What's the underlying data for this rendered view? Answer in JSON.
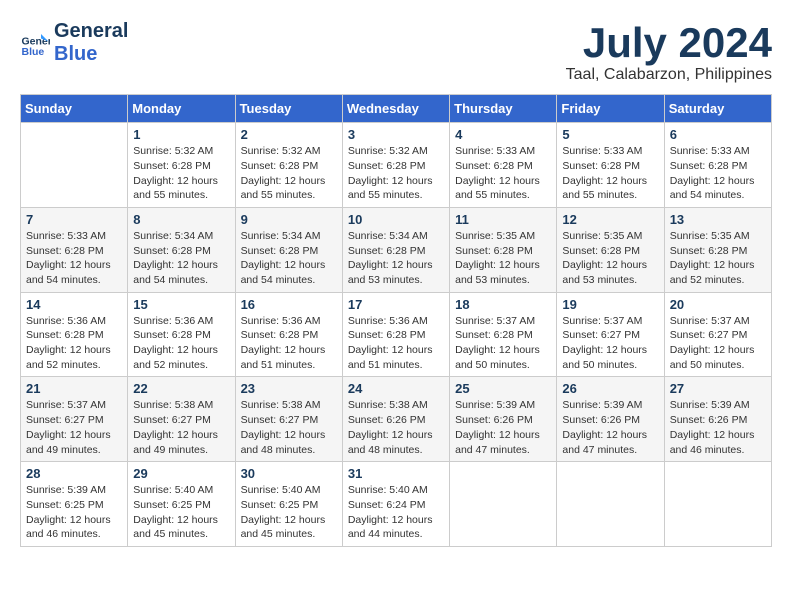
{
  "header": {
    "logo_line1": "General",
    "logo_line2": "Blue",
    "month": "July 2024",
    "location": "Taal, Calabarzon, Philippines"
  },
  "days_of_week": [
    "Sunday",
    "Monday",
    "Tuesday",
    "Wednesday",
    "Thursday",
    "Friday",
    "Saturday"
  ],
  "weeks": [
    [
      {
        "day": "",
        "content": ""
      },
      {
        "day": "1",
        "content": "Sunrise: 5:32 AM\nSunset: 6:28 PM\nDaylight: 12 hours\nand 55 minutes."
      },
      {
        "day": "2",
        "content": "Sunrise: 5:32 AM\nSunset: 6:28 PM\nDaylight: 12 hours\nand 55 minutes."
      },
      {
        "day": "3",
        "content": "Sunrise: 5:32 AM\nSunset: 6:28 PM\nDaylight: 12 hours\nand 55 minutes."
      },
      {
        "day": "4",
        "content": "Sunrise: 5:33 AM\nSunset: 6:28 PM\nDaylight: 12 hours\nand 55 minutes."
      },
      {
        "day": "5",
        "content": "Sunrise: 5:33 AM\nSunset: 6:28 PM\nDaylight: 12 hours\nand 55 minutes."
      },
      {
        "day": "6",
        "content": "Sunrise: 5:33 AM\nSunset: 6:28 PM\nDaylight: 12 hours\nand 54 minutes."
      }
    ],
    [
      {
        "day": "7",
        "content": "Sunrise: 5:33 AM\nSunset: 6:28 PM\nDaylight: 12 hours\nand 54 minutes."
      },
      {
        "day": "8",
        "content": "Sunrise: 5:34 AM\nSunset: 6:28 PM\nDaylight: 12 hours\nand 54 minutes."
      },
      {
        "day": "9",
        "content": "Sunrise: 5:34 AM\nSunset: 6:28 PM\nDaylight: 12 hours\nand 54 minutes."
      },
      {
        "day": "10",
        "content": "Sunrise: 5:34 AM\nSunset: 6:28 PM\nDaylight: 12 hours\nand 53 minutes."
      },
      {
        "day": "11",
        "content": "Sunrise: 5:35 AM\nSunset: 6:28 PM\nDaylight: 12 hours\nand 53 minutes."
      },
      {
        "day": "12",
        "content": "Sunrise: 5:35 AM\nSunset: 6:28 PM\nDaylight: 12 hours\nand 53 minutes."
      },
      {
        "day": "13",
        "content": "Sunrise: 5:35 AM\nSunset: 6:28 PM\nDaylight: 12 hours\nand 52 minutes."
      }
    ],
    [
      {
        "day": "14",
        "content": "Sunrise: 5:36 AM\nSunset: 6:28 PM\nDaylight: 12 hours\nand 52 minutes."
      },
      {
        "day": "15",
        "content": "Sunrise: 5:36 AM\nSunset: 6:28 PM\nDaylight: 12 hours\nand 52 minutes."
      },
      {
        "day": "16",
        "content": "Sunrise: 5:36 AM\nSunset: 6:28 PM\nDaylight: 12 hours\nand 51 minutes."
      },
      {
        "day": "17",
        "content": "Sunrise: 5:36 AM\nSunset: 6:28 PM\nDaylight: 12 hours\nand 51 minutes."
      },
      {
        "day": "18",
        "content": "Sunrise: 5:37 AM\nSunset: 6:28 PM\nDaylight: 12 hours\nand 50 minutes."
      },
      {
        "day": "19",
        "content": "Sunrise: 5:37 AM\nSunset: 6:27 PM\nDaylight: 12 hours\nand 50 minutes."
      },
      {
        "day": "20",
        "content": "Sunrise: 5:37 AM\nSunset: 6:27 PM\nDaylight: 12 hours\nand 50 minutes."
      }
    ],
    [
      {
        "day": "21",
        "content": "Sunrise: 5:37 AM\nSunset: 6:27 PM\nDaylight: 12 hours\nand 49 minutes."
      },
      {
        "day": "22",
        "content": "Sunrise: 5:38 AM\nSunset: 6:27 PM\nDaylight: 12 hours\nand 49 minutes."
      },
      {
        "day": "23",
        "content": "Sunrise: 5:38 AM\nSunset: 6:27 PM\nDaylight: 12 hours\nand 48 minutes."
      },
      {
        "day": "24",
        "content": "Sunrise: 5:38 AM\nSunset: 6:26 PM\nDaylight: 12 hours\nand 48 minutes."
      },
      {
        "day": "25",
        "content": "Sunrise: 5:39 AM\nSunset: 6:26 PM\nDaylight: 12 hours\nand 47 minutes."
      },
      {
        "day": "26",
        "content": "Sunrise: 5:39 AM\nSunset: 6:26 PM\nDaylight: 12 hours\nand 47 minutes."
      },
      {
        "day": "27",
        "content": "Sunrise: 5:39 AM\nSunset: 6:26 PM\nDaylight: 12 hours\nand 46 minutes."
      }
    ],
    [
      {
        "day": "28",
        "content": "Sunrise: 5:39 AM\nSunset: 6:25 PM\nDaylight: 12 hours\nand 46 minutes."
      },
      {
        "day": "29",
        "content": "Sunrise: 5:40 AM\nSunset: 6:25 PM\nDaylight: 12 hours\nand 45 minutes."
      },
      {
        "day": "30",
        "content": "Sunrise: 5:40 AM\nSunset: 6:25 PM\nDaylight: 12 hours\nand 45 minutes."
      },
      {
        "day": "31",
        "content": "Sunrise: 5:40 AM\nSunset: 6:24 PM\nDaylight: 12 hours\nand 44 minutes."
      },
      {
        "day": "",
        "content": ""
      },
      {
        "day": "",
        "content": ""
      },
      {
        "day": "",
        "content": ""
      }
    ]
  ]
}
